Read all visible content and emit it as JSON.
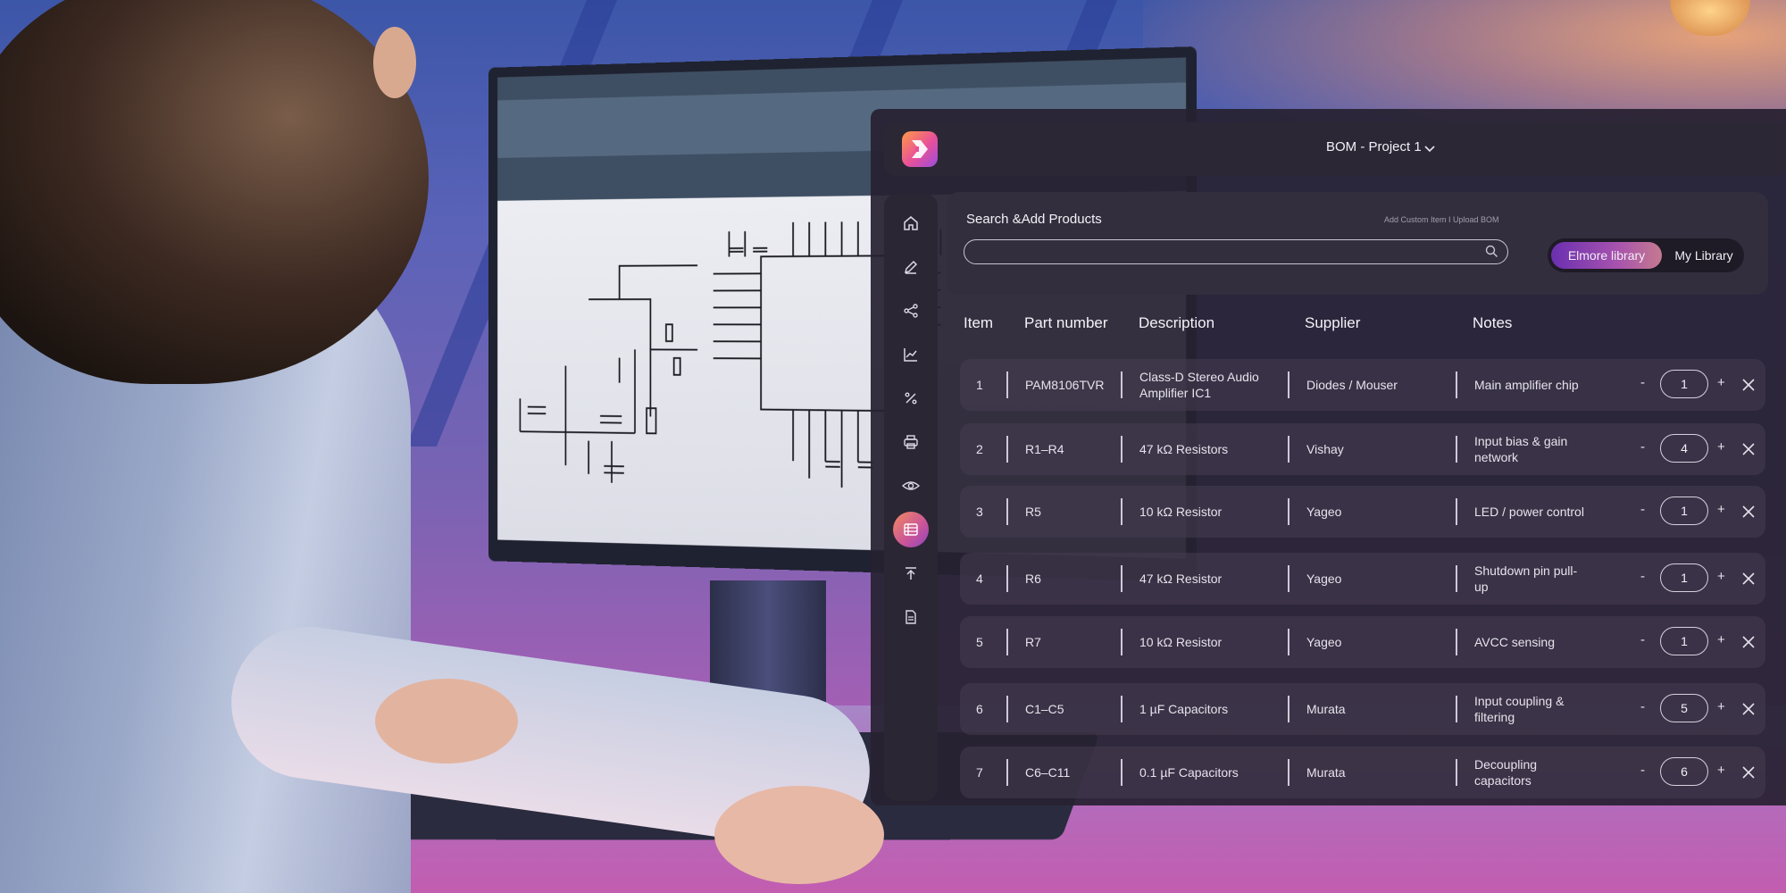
{
  "app": {
    "project_title": "BOM - Project 1"
  },
  "search": {
    "title": "Search &Add Products",
    "links": "Add Custom Item I Upload BOM",
    "value": "",
    "placeholder": ""
  },
  "library_toggle": {
    "selected": "Elmore library",
    "other": "My Library"
  },
  "table": {
    "headers": [
      "Item",
      "Part number",
      "Description",
      "Supplier",
      "Notes"
    ],
    "rows": [
      {
        "item": "1",
        "part": "PAM8106TVR",
        "desc": "Class-D Stereo Audio Amplifier IC1",
        "supplier": "Diodes / Mouser",
        "notes": "Main amplifier chip",
        "qty": "1"
      },
      {
        "item": "2",
        "part": "R1–R4",
        "desc": "47 kΩ Resistors",
        "supplier": "Vishay",
        "notes": "Input bias & gain network",
        "qty": "4"
      },
      {
        "item": "3",
        "part": "R5",
        "desc": "10 kΩ Resistor",
        "supplier": "Yageo",
        "notes": "LED / power control",
        "qty": "1"
      },
      {
        "item": "4",
        "part": "R6",
        "desc": "47 kΩ Resistor",
        "supplier": "Yageo",
        "notes": "Shutdown pin pull-up",
        "qty": "1"
      },
      {
        "item": "5",
        "part": "R7",
        "desc": "10 kΩ Resistor",
        "supplier": "Yageo",
        "notes": "AVCC sensing",
        "qty": "1"
      },
      {
        "item": "6",
        "part": "C1–C5",
        "desc": "1 µF Capacitors",
        "supplier": "Murata",
        "notes": "Input coupling & filtering",
        "qty": "5"
      },
      {
        "item": "7",
        "part": "C6–C11",
        "desc": "0.1 µF Capacitors",
        "supplier": "Murata",
        "notes": "Decoupling capacitors",
        "qty": "6"
      }
    ],
    "minus_label": "-",
    "plus_label": "+"
  },
  "nav_icons": [
    "home-icon",
    "pencil-icon",
    "share-nodes-icon",
    "chart-line-icon",
    "percent-icon",
    "printer-icon",
    "eye-icon",
    "list-table-icon",
    "upload-icon",
    "document-icon"
  ],
  "colors": {
    "panel": "#272132",
    "accent_gradient_start": "#6a2fb0",
    "accent_gradient_end": "#c57a8e",
    "logo_orange": "#ff9a45",
    "logo_purple": "#9b4dde"
  }
}
